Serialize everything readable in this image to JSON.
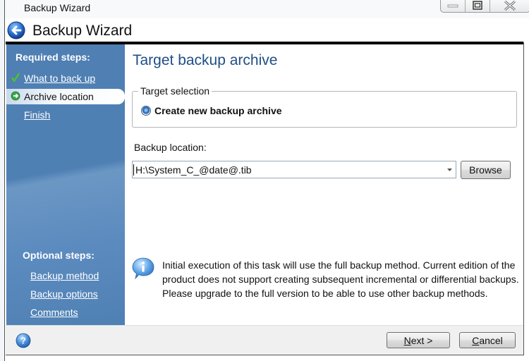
{
  "window": {
    "title": "Backup Wizard",
    "controls": {
      "minimize": "minimize",
      "maximize": "maximize",
      "close": "close"
    }
  },
  "header": {
    "back_icon": "back-arrow-icon",
    "title": "Backup Wizard"
  },
  "sidebar": {
    "required_heading": "Required steps:",
    "required_steps": [
      {
        "label": "What to back up",
        "state": "completed",
        "icon": "checkmark-icon"
      },
      {
        "label": "Archive location",
        "state": "current",
        "icon": "arrow-right-icon"
      },
      {
        "label": "Finish",
        "state": "pending",
        "icon": ""
      }
    ],
    "optional_heading": "Optional steps:",
    "optional_steps": [
      {
        "label": "Backup method"
      },
      {
        "label": "Backup options"
      },
      {
        "label": "Comments"
      }
    ]
  },
  "main": {
    "title": "Target backup archive",
    "target_selection": {
      "legend": "Target selection",
      "option_label": "Create new backup archive",
      "selected": true
    },
    "location": {
      "label": "Backup location:",
      "value": "H:\\System_C_@date@.tib",
      "browse_label": "Browse"
    },
    "info": {
      "icon": "info-icon",
      "text": "Initial execution of this task will use the full backup method. Current edition of the product does not support creating subsequent incremental or differential backups. Please upgrade to the full version to be able to use other backup methods."
    }
  },
  "footer": {
    "help_icon": "help-icon",
    "next_accel": "N",
    "next_rest": "ext >",
    "cancel_accel": "C",
    "cancel_rest": "ancel"
  },
  "colors": {
    "sidebar_bg": "#4f80b4",
    "title_blue": "#1f4e84",
    "check_green": "#4cc22a"
  }
}
